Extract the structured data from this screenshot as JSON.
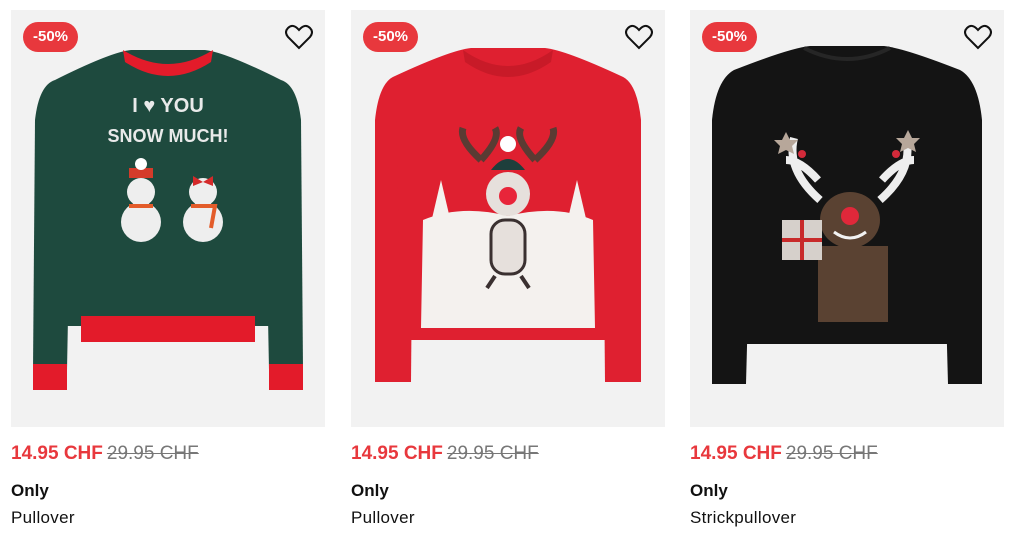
{
  "products": [
    {
      "badge": "-50%",
      "price_now": "14.95 CHF",
      "price_old": "29.95 CHF",
      "brand": "Only",
      "type": "Pullover",
      "print_text_line1": "I ♥ YOU",
      "print_text_line2": "SNOW MUCH!",
      "colors": {
        "body": "#1e4a3e",
        "trim": "#e31b2a"
      }
    },
    {
      "badge": "-50%",
      "price_now": "14.95 CHF",
      "price_old": "29.95 CHF",
      "brand": "Only",
      "type": "Pullover",
      "colors": {
        "body": "#df2030",
        "trim": "#df2030"
      }
    },
    {
      "badge": "-50%",
      "price_now": "14.95 CHF",
      "price_old": "29.95 CHF",
      "brand": "Only",
      "type": "Strickpullover",
      "colors": {
        "body": "#141414",
        "trim": "#141414"
      }
    }
  ],
  "icons": {
    "wishlist": "heart-outline-icon"
  },
  "accent": "#e8383d"
}
